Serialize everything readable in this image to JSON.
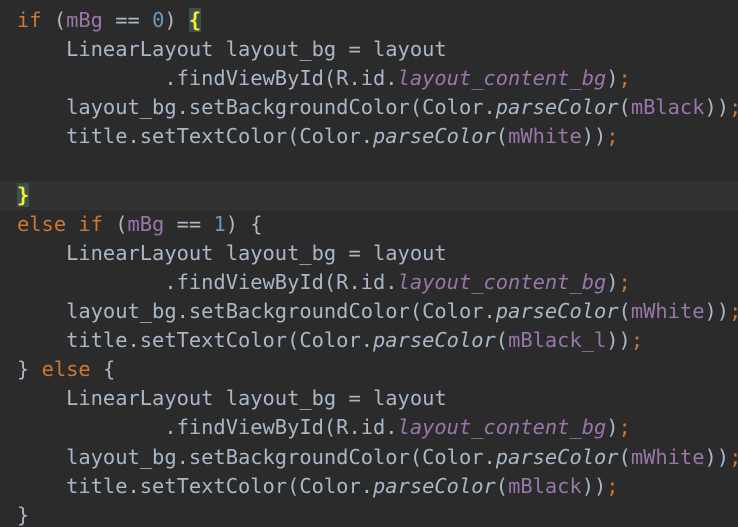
{
  "editor": {
    "theme": {
      "background": "#2b2b2b",
      "keyword": "#cc7832",
      "field": "#9876aa",
      "number": "#6897bb",
      "text": "#a9b7c6",
      "brace_highlight": "#ffef28"
    },
    "lines": [
      {
        "tokens": [
          [
            "kw",
            "if "
          ],
          [
            "txt",
            "("
          ],
          [
            "field",
            "mBg"
          ],
          [
            "txt",
            " == "
          ],
          [
            "num",
            "0"
          ],
          [
            "txt",
            ") "
          ],
          [
            "brace",
            "{"
          ]
        ]
      },
      {
        "tokens": [
          [
            "txt",
            "    LinearLayout layout_bg = layout"
          ]
        ]
      },
      {
        "tokens": [
          [
            "txt",
            "            .findViewById(R.id."
          ],
          [
            "ital",
            "layout_content_bg"
          ],
          [
            "txt",
            ")"
          ],
          [
            "punct",
            ";"
          ]
        ]
      },
      {
        "tokens": [
          [
            "txt",
            "    layout_bg.setBackgroundColor(Color."
          ],
          [
            "meth",
            "parseColor"
          ],
          [
            "txt",
            "("
          ],
          [
            "field",
            "mBlack"
          ],
          [
            "txt",
            "))"
          ],
          [
            "punct",
            ";"
          ]
        ]
      },
      {
        "tokens": [
          [
            "txt",
            "    title.setTextColor(Color."
          ],
          [
            "meth",
            "parseColor"
          ],
          [
            "txt",
            "("
          ],
          [
            "field",
            "mWhite"
          ],
          [
            "txt",
            "))"
          ],
          [
            "punct",
            ";"
          ]
        ]
      },
      {
        "tokens": [
          [
            "txt",
            ""
          ]
        ]
      },
      {
        "current": true,
        "tokens": [
          [
            "brace",
            "}"
          ]
        ]
      },
      {
        "tokens": [
          [
            "kw",
            "else if "
          ],
          [
            "txt",
            "("
          ],
          [
            "field",
            "mBg"
          ],
          [
            "txt",
            " == "
          ],
          [
            "num",
            "1"
          ],
          [
            "txt",
            ") {"
          ]
        ]
      },
      {
        "tokens": [
          [
            "txt",
            "    LinearLayout layout_bg = layout"
          ]
        ]
      },
      {
        "tokens": [
          [
            "txt",
            "            .findViewById(R.id."
          ],
          [
            "ital",
            "layout_content_bg"
          ],
          [
            "txt",
            ")"
          ],
          [
            "punct",
            ";"
          ]
        ]
      },
      {
        "tokens": [
          [
            "txt",
            "    layout_bg.setBackgroundColor(Color."
          ],
          [
            "meth",
            "parseColor"
          ],
          [
            "txt",
            "("
          ],
          [
            "field",
            "mWhite"
          ],
          [
            "txt",
            "))"
          ],
          [
            "punct",
            ";"
          ]
        ]
      },
      {
        "tokens": [
          [
            "txt",
            "    title.setTextColor(Color."
          ],
          [
            "meth",
            "parseColor"
          ],
          [
            "txt",
            "("
          ],
          [
            "field",
            "mBlack_l"
          ],
          [
            "txt",
            "))"
          ],
          [
            "punct",
            ";"
          ]
        ]
      },
      {
        "tokens": [
          [
            "txt",
            "} "
          ],
          [
            "kw",
            "else "
          ],
          [
            "txt",
            "{"
          ]
        ]
      },
      {
        "tokens": [
          [
            "txt",
            "    LinearLayout layout_bg = layout"
          ]
        ]
      },
      {
        "tokens": [
          [
            "txt",
            "            .findViewById(R.id."
          ],
          [
            "ital",
            "layout_content_bg"
          ],
          [
            "txt",
            ")"
          ],
          [
            "punct",
            ";"
          ]
        ]
      },
      {
        "tokens": [
          [
            "txt",
            "    layout_bg.setBackgroundColor(Color."
          ],
          [
            "meth",
            "parseColor"
          ],
          [
            "txt",
            "("
          ],
          [
            "field",
            "mWhite"
          ],
          [
            "txt",
            "))"
          ],
          [
            "punct",
            ";"
          ]
        ]
      },
      {
        "tokens": [
          [
            "txt",
            "    title.setTextColor(Color."
          ],
          [
            "meth",
            "parseColor"
          ],
          [
            "txt",
            "("
          ],
          [
            "field",
            "mBlack"
          ],
          [
            "txt",
            "))"
          ],
          [
            "punct",
            ";"
          ]
        ]
      },
      {
        "tokens": [
          [
            "txt",
            "}"
          ]
        ]
      }
    ]
  }
}
